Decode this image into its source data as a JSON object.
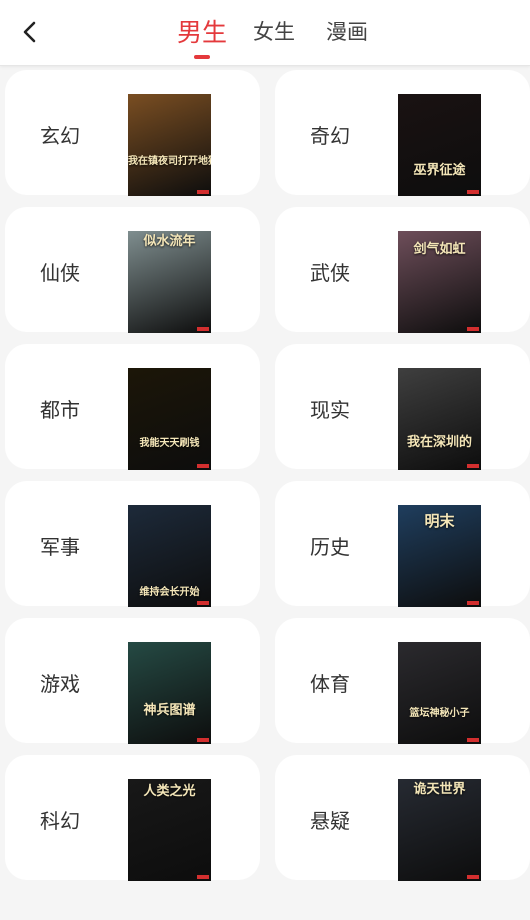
{
  "header": {
    "back_icon": "chevron-left-icon",
    "tabs": [
      {
        "label": "男生",
        "active": true
      },
      {
        "label": "女生",
        "active": false
      },
      {
        "label": "漫画",
        "active": false
      }
    ]
  },
  "categories": [
    {
      "label": "玄幻",
      "cover_title": "我在镇夜司打开地狱之门",
      "cover_color": "#7a4e22"
    },
    {
      "label": "奇幻",
      "cover_title": "巫界征途",
      "cover_color": "#1a1212"
    },
    {
      "label": "仙侠",
      "cover_title": "似水流年",
      "cover_color": "#7f8e8f"
    },
    {
      "label": "武侠",
      "cover_title": "剑气如虹",
      "cover_color": "#6e4e5a"
    },
    {
      "label": "都市",
      "cover_title": "我能天天刷钱",
      "cover_color": "#1c1608"
    },
    {
      "label": "现实",
      "cover_title": "我在深圳的",
      "cover_color": "#3f3f3f"
    },
    {
      "label": "军事",
      "cover_title": "维持会长开始",
      "cover_color": "#1d2a3a"
    },
    {
      "label": "历史",
      "cover_title": "明末",
      "cover_color": "#1f3e5e"
    },
    {
      "label": "游戏",
      "cover_title": "神兵图谱",
      "cover_color": "#254a44"
    },
    {
      "label": "体育",
      "cover_title": "篮坛神秘小子",
      "cover_color": "#2b2a2e"
    },
    {
      "label": "科幻",
      "cover_title": "人类之光",
      "cover_color": "#181818"
    },
    {
      "label": "悬疑",
      "cover_title": "诡天世界",
      "cover_color": "#262a32"
    }
  ],
  "colors": {
    "accent": "#e4393c",
    "background": "#f5f5f5",
    "card": "#ffffff"
  }
}
